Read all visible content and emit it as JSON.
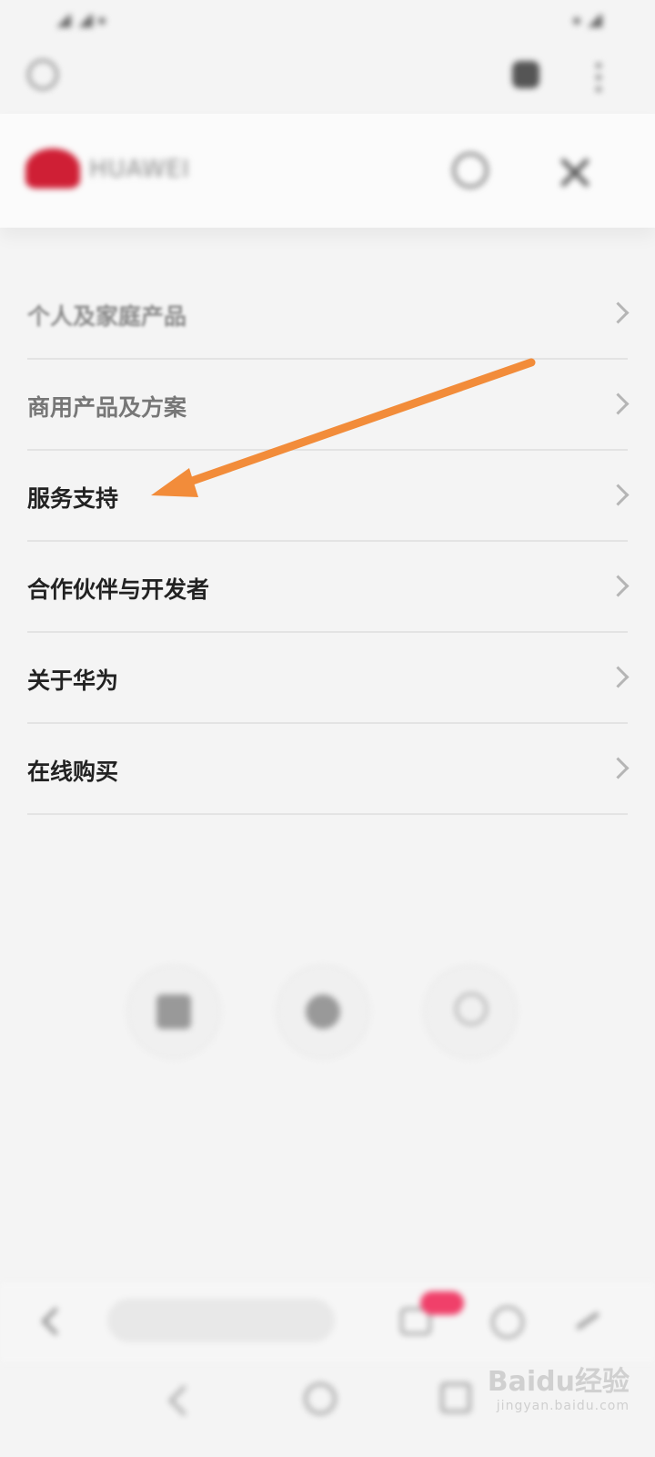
{
  "menu": {
    "items": [
      {
        "label": "个人及家庭产品"
      },
      {
        "label": "商用产品及方案"
      },
      {
        "label": "服务支持"
      },
      {
        "label": "合作伙伴与开发者"
      },
      {
        "label": "关于华为"
      },
      {
        "label": "在线购买"
      }
    ]
  },
  "header": {
    "brand": "HUAWEI",
    "brand_color": "#cf1f35"
  },
  "annotation": {
    "arrow_color": "#f28c3a"
  },
  "watermark": {
    "main": "Baidu经验",
    "sub": "jingyan.baidu.com"
  }
}
